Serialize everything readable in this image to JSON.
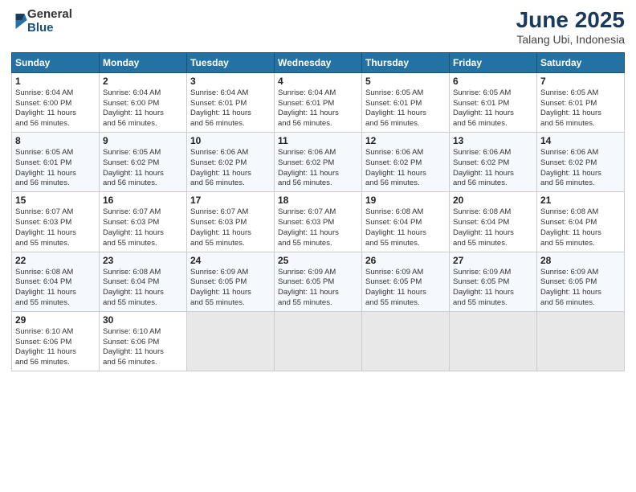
{
  "logo": {
    "general": "General",
    "blue": "Blue"
  },
  "header": {
    "month_year": "June 2025",
    "location": "Talang Ubi, Indonesia"
  },
  "weekdays": [
    "Sunday",
    "Monday",
    "Tuesday",
    "Wednesday",
    "Thursday",
    "Friday",
    "Saturday"
  ],
  "weeks": [
    [
      {
        "day": "1",
        "info": "Sunrise: 6:04 AM\nSunset: 6:00 PM\nDaylight: 11 hours\nand 56 minutes."
      },
      {
        "day": "2",
        "info": "Sunrise: 6:04 AM\nSunset: 6:00 PM\nDaylight: 11 hours\nand 56 minutes."
      },
      {
        "day": "3",
        "info": "Sunrise: 6:04 AM\nSunset: 6:01 PM\nDaylight: 11 hours\nand 56 minutes."
      },
      {
        "day": "4",
        "info": "Sunrise: 6:04 AM\nSunset: 6:01 PM\nDaylight: 11 hours\nand 56 minutes."
      },
      {
        "day": "5",
        "info": "Sunrise: 6:05 AM\nSunset: 6:01 PM\nDaylight: 11 hours\nand 56 minutes."
      },
      {
        "day": "6",
        "info": "Sunrise: 6:05 AM\nSunset: 6:01 PM\nDaylight: 11 hours\nand 56 minutes."
      },
      {
        "day": "7",
        "info": "Sunrise: 6:05 AM\nSunset: 6:01 PM\nDaylight: 11 hours\nand 56 minutes."
      }
    ],
    [
      {
        "day": "8",
        "info": "Sunrise: 6:05 AM\nSunset: 6:01 PM\nDaylight: 11 hours\nand 56 minutes."
      },
      {
        "day": "9",
        "info": "Sunrise: 6:05 AM\nSunset: 6:02 PM\nDaylight: 11 hours\nand 56 minutes."
      },
      {
        "day": "10",
        "info": "Sunrise: 6:06 AM\nSunset: 6:02 PM\nDaylight: 11 hours\nand 56 minutes."
      },
      {
        "day": "11",
        "info": "Sunrise: 6:06 AM\nSunset: 6:02 PM\nDaylight: 11 hours\nand 56 minutes."
      },
      {
        "day": "12",
        "info": "Sunrise: 6:06 AM\nSunset: 6:02 PM\nDaylight: 11 hours\nand 56 minutes."
      },
      {
        "day": "13",
        "info": "Sunrise: 6:06 AM\nSunset: 6:02 PM\nDaylight: 11 hours\nand 56 minutes."
      },
      {
        "day": "14",
        "info": "Sunrise: 6:06 AM\nSunset: 6:02 PM\nDaylight: 11 hours\nand 56 minutes."
      }
    ],
    [
      {
        "day": "15",
        "info": "Sunrise: 6:07 AM\nSunset: 6:03 PM\nDaylight: 11 hours\nand 55 minutes."
      },
      {
        "day": "16",
        "info": "Sunrise: 6:07 AM\nSunset: 6:03 PM\nDaylight: 11 hours\nand 55 minutes."
      },
      {
        "day": "17",
        "info": "Sunrise: 6:07 AM\nSunset: 6:03 PM\nDaylight: 11 hours\nand 55 minutes."
      },
      {
        "day": "18",
        "info": "Sunrise: 6:07 AM\nSunset: 6:03 PM\nDaylight: 11 hours\nand 55 minutes."
      },
      {
        "day": "19",
        "info": "Sunrise: 6:08 AM\nSunset: 6:04 PM\nDaylight: 11 hours\nand 55 minutes."
      },
      {
        "day": "20",
        "info": "Sunrise: 6:08 AM\nSunset: 6:04 PM\nDaylight: 11 hours\nand 55 minutes."
      },
      {
        "day": "21",
        "info": "Sunrise: 6:08 AM\nSunset: 6:04 PM\nDaylight: 11 hours\nand 55 minutes."
      }
    ],
    [
      {
        "day": "22",
        "info": "Sunrise: 6:08 AM\nSunset: 6:04 PM\nDaylight: 11 hours\nand 55 minutes."
      },
      {
        "day": "23",
        "info": "Sunrise: 6:08 AM\nSunset: 6:04 PM\nDaylight: 11 hours\nand 55 minutes."
      },
      {
        "day": "24",
        "info": "Sunrise: 6:09 AM\nSunset: 6:05 PM\nDaylight: 11 hours\nand 55 minutes."
      },
      {
        "day": "25",
        "info": "Sunrise: 6:09 AM\nSunset: 6:05 PM\nDaylight: 11 hours\nand 55 minutes."
      },
      {
        "day": "26",
        "info": "Sunrise: 6:09 AM\nSunset: 6:05 PM\nDaylight: 11 hours\nand 55 minutes."
      },
      {
        "day": "27",
        "info": "Sunrise: 6:09 AM\nSunset: 6:05 PM\nDaylight: 11 hours\nand 55 minutes."
      },
      {
        "day": "28",
        "info": "Sunrise: 6:09 AM\nSunset: 6:05 PM\nDaylight: 11 hours\nand 56 minutes."
      }
    ],
    [
      {
        "day": "29",
        "info": "Sunrise: 6:10 AM\nSunset: 6:06 PM\nDaylight: 11 hours\nand 56 minutes."
      },
      {
        "day": "30",
        "info": "Sunrise: 6:10 AM\nSunset: 6:06 PM\nDaylight: 11 hours\nand 56 minutes."
      },
      null,
      null,
      null,
      null,
      null
    ]
  ]
}
